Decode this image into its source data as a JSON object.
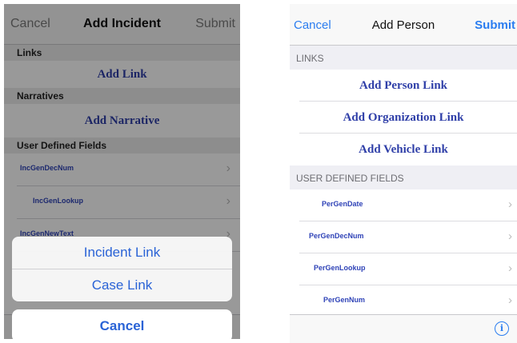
{
  "left": {
    "nav": {
      "cancel": "Cancel",
      "title": "Add Incident",
      "submit": "Submit"
    },
    "sections": {
      "links": "Links",
      "narratives": "Narratives",
      "user_defined": "User Defined Fields"
    },
    "actions": {
      "add_link": "Add Link",
      "add_narrative": "Add Narrative"
    },
    "fields": [
      "IncGenDecNum",
      "IncGenLookup",
      "IncGenNewText"
    ],
    "action_sheet": {
      "options": [
        "Incident Link",
        "Case Link"
      ],
      "cancel": "Cancel"
    },
    "toolbar_icons": [
      "document-icon",
      "person-icon",
      "link-icon",
      "info-icon"
    ]
  },
  "right": {
    "nav": {
      "cancel": "Cancel",
      "title": "Add Person",
      "submit": "Submit"
    },
    "sections": {
      "links": "LINKS",
      "user_defined": "USER DEFINED FIELDS"
    },
    "actions": [
      "Add Person Link",
      "Add Organization Link",
      "Add Vehicle Link"
    ],
    "fields": [
      "PerGenDate",
      "PerGenDecNum",
      "PerGenLookup",
      "PerGenNum"
    ],
    "info_icon": "i"
  },
  "colors": {
    "ios_blue": "#2a7df0",
    "link_serif_blue": "#2f3fa8",
    "field_blue": "#2f43b7"
  }
}
